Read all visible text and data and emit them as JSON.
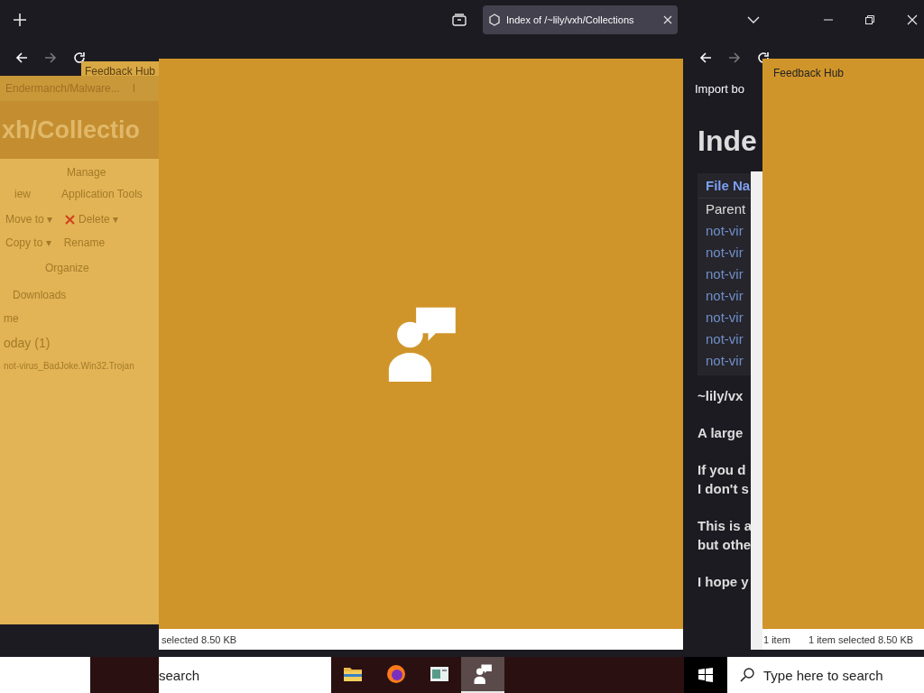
{
  "browser_tabs": [
    {
      "label": "Index of /~lily/vxh/Collections",
      "selected": true
    }
  ],
  "left_view": {
    "window_title": "Feedback Hub",
    "bookmarks": [
      "Endermanch/Malware...",
      "I"
    ],
    "heading": "xh/Collectio",
    "ribbon_tabs": [
      "iew",
      "Application Tools"
    ],
    "ribbon_group": "Manage",
    "commands": [
      {
        "label": "Move to ▾",
        "kind": "move"
      },
      {
        "label": "Delete ▾",
        "kind": "delete"
      },
      {
        "label": "Copy to ▾",
        "kind": "copy"
      },
      {
        "label": "Rename",
        "kind": "rename"
      }
    ],
    "command_group": "Organize",
    "breadcrumb": "Downloads",
    "column": "me",
    "group": "oday (1)",
    "file": "not-virus_BadJoke.Win32.Trojan",
    "status": "selected  8.50 KB"
  },
  "right_view": {
    "bookmark": "Import bo",
    "heading": "Inde",
    "table_header": "File Na",
    "rows": [
      "Parent",
      "not-vir",
      "not-vir",
      "not-vir",
      "not-vir",
      "not-vir",
      "not-vir",
      "not-vir"
    ],
    "paragraphs": [
      [
        "~lily/vx"
      ],
      [
        "A large"
      ],
      [
        "If you d",
        "I don't s"
      ],
      [
        "This is a",
        "but othe"
      ],
      [
        "I hope y"
      ]
    ],
    "window_title": "Feedback Hub",
    "status_count": "1 item",
    "status_selected": "1 item selected  8.50 KB"
  },
  "taskbar": {
    "left_search": "search",
    "search_placeholder": "Type here to search",
    "apps": [
      {
        "kind": "folder",
        "selected": false
      },
      {
        "kind": "firefox",
        "selected": false
      },
      {
        "kind": "app",
        "selected": false
      },
      {
        "kind": "feedback",
        "selected": true
      }
    ]
  }
}
